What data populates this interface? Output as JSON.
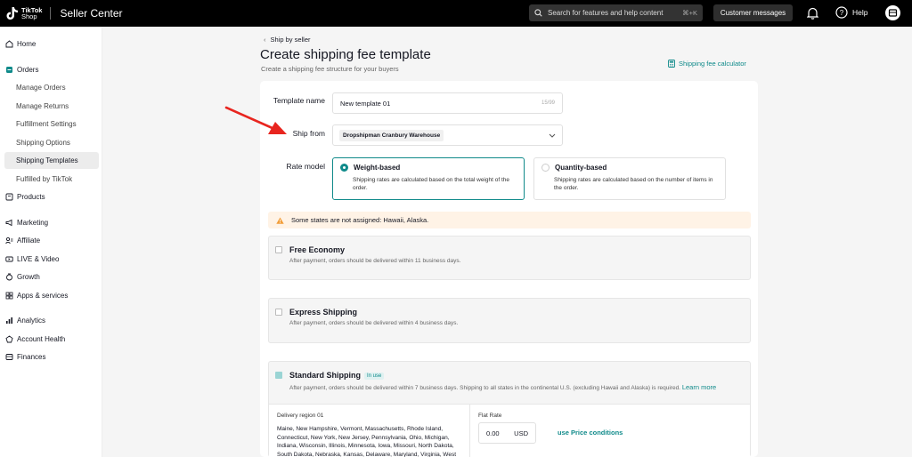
{
  "topbar": {
    "logo_line1": "TikTok",
    "logo_line2": "Shop",
    "app_title": "Seller Center",
    "search_placeholder": "Search for features and help content",
    "search_shortcut": "⌘+K",
    "customer_messages": "Customer messages",
    "help": "Help"
  },
  "sidebar": {
    "items": [
      {
        "label": "Home",
        "icon": "home-icon"
      },
      {
        "label": "Orders",
        "icon": "orders-icon"
      },
      {
        "label": "Manage Orders"
      },
      {
        "label": "Manage Returns"
      },
      {
        "label": "Fulfillment Settings"
      },
      {
        "label": "Shipping Options"
      },
      {
        "label": "Shipping Templates"
      },
      {
        "label": "Fulfilled by TikTok"
      },
      {
        "label": "Products",
        "icon": "products-icon"
      },
      {
        "label": "Marketing",
        "icon": "megaphone-icon"
      },
      {
        "label": "Affiliate",
        "icon": "affiliate-icon"
      },
      {
        "label": "LIVE & Video",
        "icon": "video-icon"
      },
      {
        "label": "Growth",
        "icon": "growth-icon"
      },
      {
        "label": "Apps & services",
        "icon": "apps-icon"
      },
      {
        "label": "Analytics",
        "icon": "analytics-icon"
      },
      {
        "label": "Account Health",
        "icon": "health-icon"
      },
      {
        "label": "Finances",
        "icon": "finances-icon"
      }
    ]
  },
  "page": {
    "back": "Ship by seller",
    "title": "Create shipping fee template",
    "subtitle": "Create a shipping fee structure for your buyers",
    "calculator": "Shipping fee calculator"
  },
  "form": {
    "template_name_label": "Template name",
    "template_name_value": "New template 01",
    "template_name_count": "15/99",
    "ship_from_label": "Ship from",
    "ship_from_value": "Dropshipman Cranbury Warehouse",
    "rate_model_label": "Rate model",
    "weight_title": "Weight-based",
    "weight_desc": "Shipping rates are calculated based on the total weight of the order.",
    "quantity_title": "Quantity-based",
    "quantity_desc": "Shipping rates are calculated based on the number of items in the order."
  },
  "warning": "Some states are not assigned: Hawaii, Alaska.",
  "shipping": {
    "free_title": "Free Economy",
    "free_desc": "After payment, orders should be delivered within 11 business days.",
    "express_title": "Express Shipping",
    "express_desc": "After payment, orders should be delivered within 4 business days.",
    "standard_title": "Standard Shipping",
    "standard_badge": "In use",
    "standard_desc": "After payment, orders should be delivered within 7 business days. Shipping to all states in the continental U.S. (excluding Hawaii and Alaska) is required.",
    "learn_more": "Learn more"
  },
  "region": {
    "header": "Delivery region 01",
    "states": "Maine, New Hampshire, Vermont, Massachusetts, Rhode Island, Connecticut, New York, New Jersey, Pennsylvania, Ohio, Michigan, Indiana, Wisconsin, Illinois, Minnesota, Iowa, Missouri, North Dakota, South Dakota, Nebraska, Kansas, Delaware, Maryland, Virginia, West",
    "flat_rate_label": "Flat Rate",
    "flat_rate_value": "0.00",
    "currency": "USD",
    "price_conditions": "use Price conditions"
  },
  "colors": {
    "accent": "#0f8a8a",
    "annotation_arrow": "#e8251f",
    "warning_bg": "#fff3e6"
  }
}
